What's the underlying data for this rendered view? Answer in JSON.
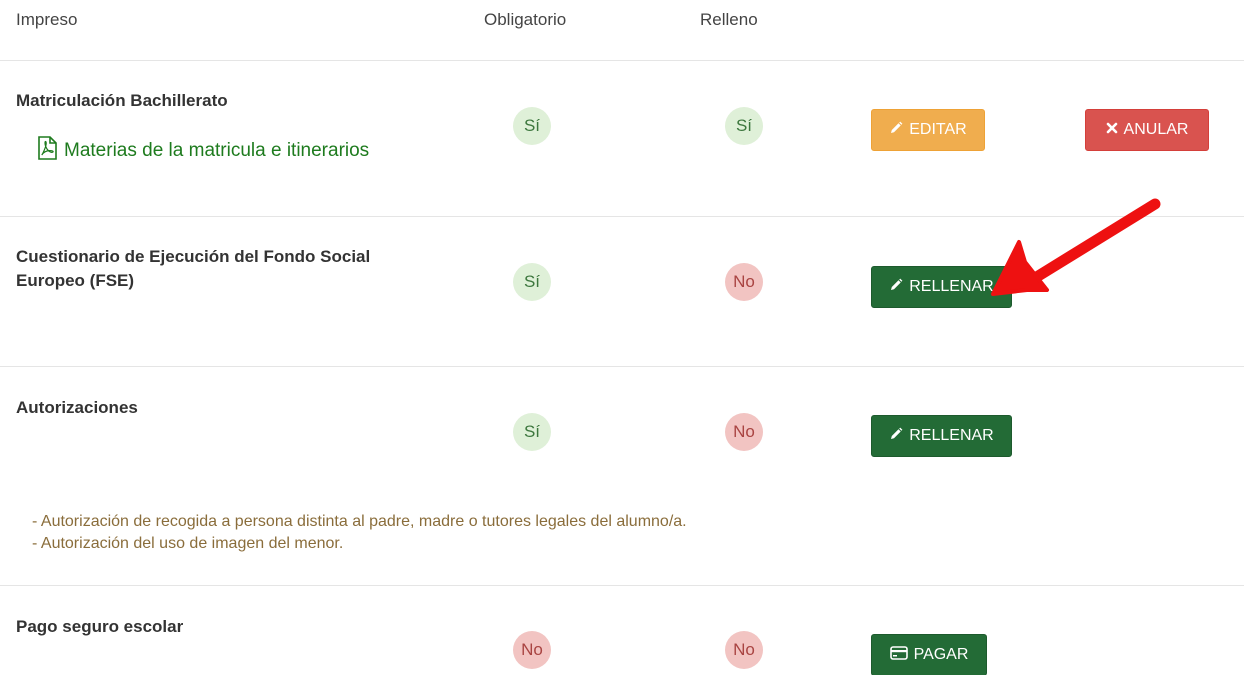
{
  "columns": {
    "impreso": "Impreso",
    "obligatorio": "Obligatorio",
    "relleno": "Relleno"
  },
  "rows": [
    {
      "title": "Matriculación Bachillerato",
      "link": {
        "label": "Materias de la matricula e itinerarios",
        "icon": "pdf-file-icon"
      },
      "obligatorio": "Sí",
      "relleno": "Sí",
      "actions": [
        {
          "label": "EDITAR",
          "icon": "pencil-icon",
          "color": "#f0ad4e"
        },
        {
          "label": "ANULAR",
          "icon": "close-icon",
          "color": "#d9534f"
        }
      ]
    },
    {
      "title": "Cuestionario de Ejecución del Fondo Social Europeo (FSE)",
      "obligatorio": "Sí",
      "relleno": "No",
      "actions": [
        {
          "label": "RELLENAR",
          "icon": "pencil-icon",
          "color": "#236b36"
        }
      ]
    },
    {
      "title": "Autorizaciones",
      "obligatorio": "Sí",
      "relleno": "No",
      "actions": [
        {
          "label": "RELLENAR",
          "icon": "pencil-icon",
          "color": "#236b36"
        }
      ],
      "notes": [
        "- Autorización de recogida a persona distinta al padre, madre o tutores legales del alumno/a.",
        "- Autorización del uso de imagen del menor."
      ]
    },
    {
      "title": "Pago seguro escolar",
      "obligatorio": "No",
      "relleno": "No",
      "actions": [
        {
          "label": "PAGAR",
          "icon": "credit-card-icon",
          "color": "#236b36"
        }
      ]
    }
  ],
  "annotation": {
    "type": "red-arrow",
    "color": "#ee1111",
    "points_to": "RELLENAR"
  },
  "colors": {
    "yes_bg": "#dff0d8",
    "yes_text": "#3c763d",
    "no_bg": "#f2c4c2",
    "no_text": "#a94442",
    "note_text": "#8a6d3b",
    "link_text": "#1e7b1e"
  }
}
